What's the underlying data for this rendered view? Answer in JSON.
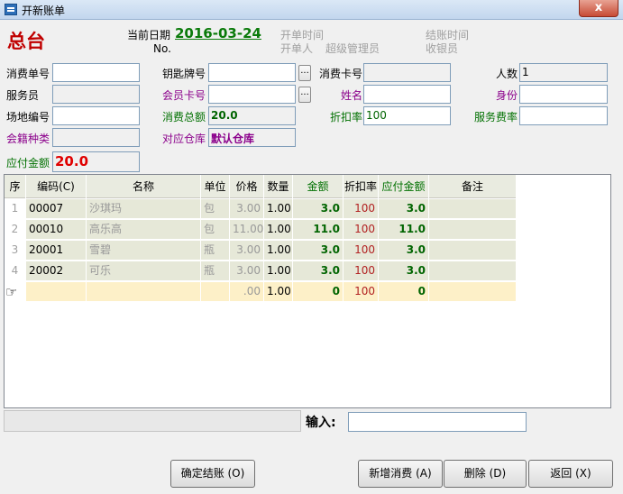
{
  "window": {
    "title": "开新账单",
    "close": "x"
  },
  "header": {
    "store_name": "总台",
    "date_label": "当前日期",
    "date_value": "2016-03-24",
    "no_label": "No.",
    "open_time_label": "开单时间",
    "opener_label": "开单人",
    "opener_value": "超级管理员",
    "checkout_time_label": "结账时间",
    "cashier_label": "收银员"
  },
  "form": {
    "consume_no_label": "消费单号",
    "consume_no_value": "",
    "key_no_label": "钥匙牌号",
    "key_no_value": "",
    "consume_card_label": "消费卡号",
    "consume_card_value": "",
    "people_label": "人数",
    "people_value": "1",
    "waiter_label": "服务员",
    "waiter_value": "",
    "member_card_label": "会员卡号",
    "member_card_value": "",
    "name_label": "姓名",
    "name_value": "",
    "identity_label": "身份",
    "identity_value": "",
    "venue_no_label": "场地编号",
    "venue_no_value": "",
    "total_label": "消费总额",
    "total_value": "20.0",
    "discount_label": "折扣率",
    "discount_value": "100",
    "service_rate_label": "服务费率",
    "service_rate_value": "",
    "member_type_label": "会籍种类",
    "member_type_value": "",
    "warehouse_label": "对应仓库",
    "warehouse_value": "默认仓库",
    "payable_label": "应付金额",
    "payable_value": "20.0",
    "dots": "..."
  },
  "grid": {
    "headers": [
      "序",
      "编码(C)",
      "名称",
      "单位",
      "价格",
      "数量",
      "金额",
      "折扣率",
      "应付金额",
      "备注"
    ],
    "rows": [
      {
        "seq": "1",
        "code": "00007",
        "name": "沙琪玛",
        "unit": "包",
        "price": "3.00",
        "qty": "1.00",
        "amount": "3.0",
        "discount": "100",
        "payable": "3.0",
        "note": ""
      },
      {
        "seq": "2",
        "code": "00010",
        "name": "高乐高",
        "unit": "包",
        "price": "11.00",
        "qty": "1.00",
        "amount": "11.0",
        "discount": "100",
        "payable": "11.0",
        "note": ""
      },
      {
        "seq": "3",
        "code": "20001",
        "name": "雪碧",
        "unit": "瓶",
        "price": "3.00",
        "qty": "1.00",
        "amount": "3.0",
        "discount": "100",
        "payable": "3.0",
        "note": ""
      },
      {
        "seq": "4",
        "code": "20002",
        "name": "可乐",
        "unit": "瓶",
        "price": "3.00",
        "qty": "1.00",
        "amount": "3.0",
        "discount": "100",
        "payable": "3.0",
        "note": ""
      },
      {
        "seq": "",
        "code": "",
        "name": "",
        "unit": "",
        "price": ".00",
        "qty": "1.00",
        "amount": "0",
        "discount": "100",
        "payable": "0",
        "note": ""
      }
    ],
    "pointer_icon": "pointing-hand-icon",
    "pointer_glyph": "☞"
  },
  "footer": {
    "input_label": "输入:",
    "input_value": "",
    "status_text": "",
    "confirm_btn": "确定结账 (O)",
    "add_btn": "新增消费 (A)",
    "delete_btn": "删除 (D)",
    "back_btn": "返回 (X)"
  },
  "colors": {
    "store_name": "#c00000",
    "date": "#0a7a0a",
    "payable": "#e00000",
    "purple_label": "#8b008b",
    "green_label": "#007000"
  }
}
